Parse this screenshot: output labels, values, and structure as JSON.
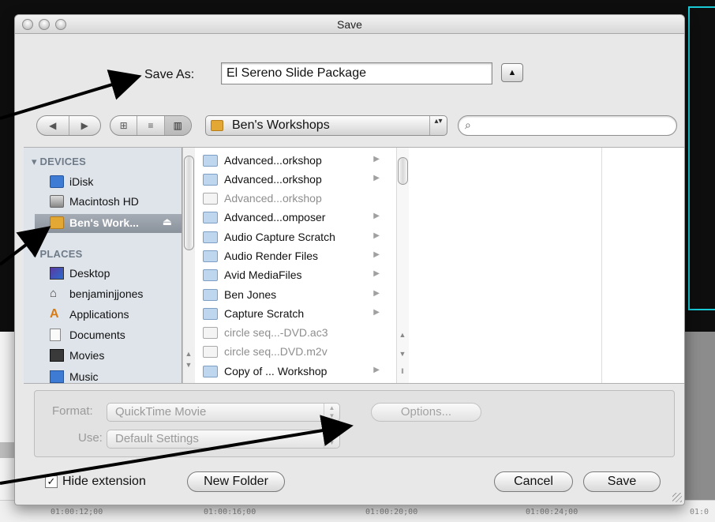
{
  "dialog": {
    "title": "Save"
  },
  "save_as": {
    "label": "Save As:",
    "value": "El Sereno Slide Package",
    "expand_icon": "▲"
  },
  "toolbar": {
    "nav": [
      "◀",
      "▶"
    ],
    "views": [
      "⊞",
      "≡",
      "▥"
    ],
    "location": "Ben's Workshops",
    "location_arrows": "▴▾",
    "search_placeholder": "",
    "search_icon": "🔍"
  },
  "sidebar": {
    "devices_header": "DEVICES",
    "places_header": "PLACES",
    "devices": [
      {
        "label": "iDisk",
        "icon": "idisk-icon"
      },
      {
        "label": "Macintosh HD",
        "icon": "hard-drive-icon"
      },
      {
        "label": "Ben's Work...",
        "icon": "folder-icon",
        "selected": true
      }
    ],
    "eject": "⏏",
    "places": [
      {
        "label": "Desktop",
        "icon": "desktop-icon"
      },
      {
        "label": "benjaminjjones",
        "icon": "home-icon"
      },
      {
        "label": "Applications",
        "icon": "applications-icon"
      },
      {
        "label": "Documents",
        "icon": "documents-icon"
      },
      {
        "label": "Movies",
        "icon": "movies-icon"
      },
      {
        "label": "Music",
        "icon": "music-icon"
      }
    ]
  },
  "files": [
    {
      "name": "Advanced...orkshop",
      "type": "folder",
      "dim": false,
      "chevron": "▶"
    },
    {
      "name": "Advanced...orkshop",
      "type": "folder",
      "dim": false,
      "chevron": "▶"
    },
    {
      "name": "Advanced...orkshop",
      "type": "document",
      "dim": true,
      "chevron": ""
    },
    {
      "name": "Advanced...omposer",
      "type": "folder",
      "dim": false,
      "chevron": "▶"
    },
    {
      "name": "Audio Capture Scratch",
      "type": "folder",
      "dim": false,
      "chevron": "▶"
    },
    {
      "name": "Audio Render Files",
      "type": "folder",
      "dim": false,
      "chevron": "▶"
    },
    {
      "name": "Avid MediaFiles",
      "type": "folder",
      "dim": false,
      "chevron": "▶"
    },
    {
      "name": "Ben Jones",
      "type": "folder",
      "dim": false,
      "chevron": "▶"
    },
    {
      "name": "Capture Scratch",
      "type": "folder",
      "dim": false,
      "chevron": "▶"
    },
    {
      "name": "circle seq...-DVD.ac3",
      "type": "document",
      "dim": true,
      "chevron": ""
    },
    {
      "name": "circle seq...DVD.m2v",
      "type": "document",
      "dim": true,
      "chevron": ""
    },
    {
      "name": "Copy of ... Workshop",
      "type": "folder",
      "dim": false,
      "chevron": "▶"
    }
  ],
  "options": {
    "format_label": "Format:",
    "format_value": "QuickTime Movie",
    "use_label": "Use:",
    "use_value": "Default Settings",
    "options_button": "Options..."
  },
  "bottom": {
    "hide_extension_label": "Hide extension",
    "hide_extension_checked": "✓",
    "new_folder": "New Folder",
    "cancel": "Cancel",
    "save": "Save"
  },
  "timeline": [
    "01:00:12;00",
    "01:00:16;00",
    "01:00:20;00",
    "01:00:24;00",
    "01:0"
  ],
  "colors": {
    "accent_cyan": "#19c9d6",
    "folder_orange": "#e3a733",
    "sidebar_bg": "#dfe4ea"
  }
}
